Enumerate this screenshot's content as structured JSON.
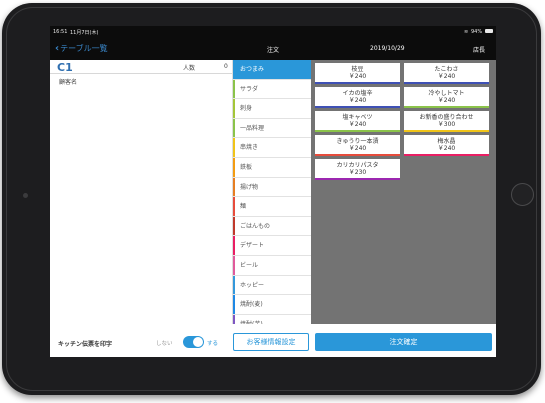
{
  "status_bar": {
    "time": "16:51",
    "date": "11月7日(木)",
    "battery": "94%"
  },
  "nav": {
    "back_label": "テーブル一覧",
    "title": "注文",
    "date": "2019/10/29",
    "staff": "店長"
  },
  "order": {
    "table_id": "C1",
    "guests_label": "人数",
    "guests_value": "0",
    "customer_label": "顧客名"
  },
  "categories": [
    {
      "label": "おつまみ",
      "color": "#2a97d9",
      "active": true
    },
    {
      "label": "サラダ",
      "color": "#8bc34a"
    },
    {
      "label": "刺身",
      "color": "#a4c639"
    },
    {
      "label": "一品料理",
      "color": "#8bc34a"
    },
    {
      "label": "串焼き",
      "color": "#f0c419"
    },
    {
      "label": "鉄板",
      "color": "#f39c12"
    },
    {
      "label": "揚げ物",
      "color": "#e67e22"
    },
    {
      "label": "麺",
      "color": "#e74c3c"
    },
    {
      "label": "ごはんもの",
      "color": "#c0392b"
    },
    {
      "label": "デザート",
      "color": "#e91e63"
    },
    {
      "label": "ビール",
      "color": "#e05a9b"
    },
    {
      "label": "ホッピー",
      "color": "#3498db"
    },
    {
      "label": "焼酎(麦)",
      "color": "#1e88e5"
    },
    {
      "label": "焼酎(芋)",
      "color": "#7e57c2"
    }
  ],
  "menu_items": [
    {
      "name": "枝豆",
      "price": "￥240",
      "color": "#3f51b5"
    },
    {
      "name": "たこわさ",
      "price": "￥240",
      "color": "#3f51b5"
    },
    {
      "name": "イカの塩辛",
      "price": "￥240",
      "color": "#3f51b5"
    },
    {
      "name": "冷やしトマト",
      "price": "￥240",
      "color": "#8bc34a"
    },
    {
      "name": "塩キャベツ",
      "price": "￥240",
      "color": "#8bc34a"
    },
    {
      "name": "お新香の盛り合わせ",
      "price": "￥300",
      "color": "#f0c419"
    },
    {
      "name": "きゅうり一本漬",
      "price": "￥240",
      "color": "#e74c3c"
    },
    {
      "name": "梅水晶",
      "price": "￥240",
      "color": "#e91e63"
    },
    {
      "name": "カリカリパスタ",
      "price": "￥230",
      "color": "#9c27b0"
    }
  ],
  "footer": {
    "kitchen_label": "キッチン伝票を印字",
    "toggle_off": "しない",
    "toggle_on": "する",
    "customer_button": "お客様情報設定",
    "confirm_button": "注文確定"
  }
}
